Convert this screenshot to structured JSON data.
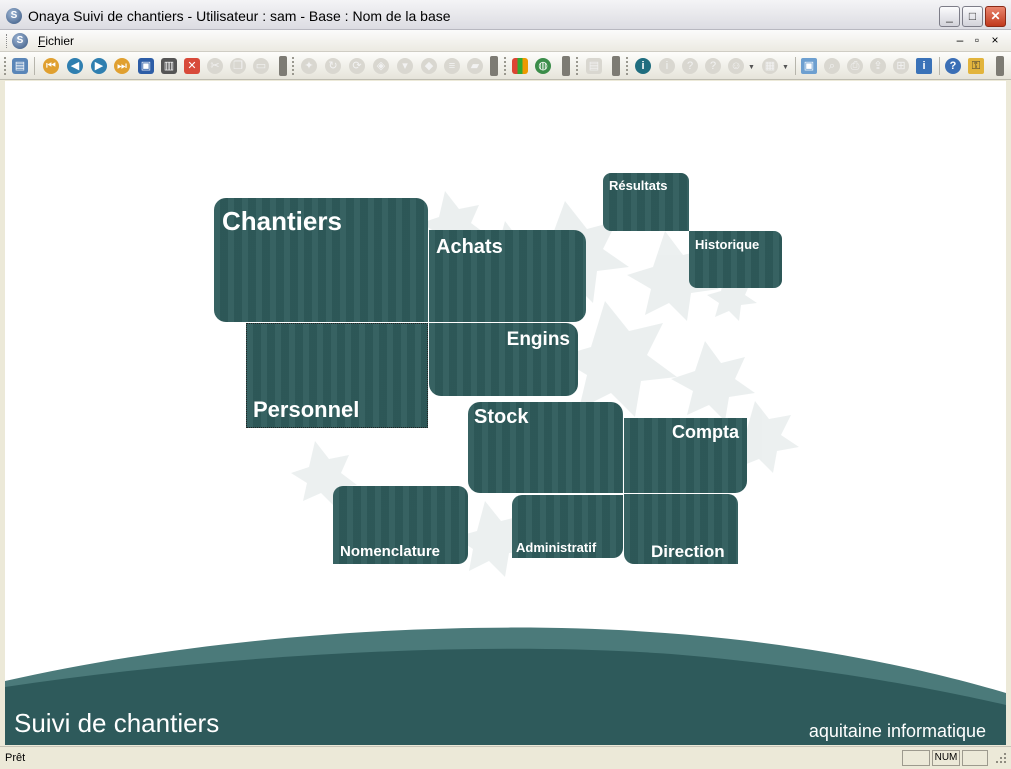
{
  "window": {
    "title": "Onaya Suivi de chantiers - Utilisateur : sam - Base : Nom de la base",
    "app_icon_glyph": "S",
    "minimize_glyph": "_",
    "maximize_glyph": "□",
    "close_glyph": "✕"
  },
  "menubar": {
    "items": [
      {
        "label": "Fichier"
      }
    ],
    "mdi_minimize_glyph": "–",
    "mdi_restore_glyph": "▫",
    "mdi_close_glyph": "×"
  },
  "toolbar": {
    "icons": [
      "notes-icon",
      "first-record-icon",
      "previous-record-icon",
      "next-record-icon",
      "last-record-icon",
      "save-icon",
      "trash-icon",
      "delete-icon",
      "cut-icon",
      "copy-icon",
      "paste-icon",
      "wand-icon",
      "rotate-icon",
      "refresh-icon",
      "lock-icon",
      "filter-icon",
      "cube-icon",
      "stack-icon",
      "eraser-icon",
      "chart-icon",
      "globe-icon",
      "report-icon",
      "info-icon",
      "info-disabled-icon",
      "help-icon",
      "help-disabled-icon",
      "dropdown-icon",
      "user-icon",
      "calendar-icon",
      "zoom-icon",
      "print-icon",
      "export-icon",
      "tree-icon",
      "about-icon",
      "help-round-icon",
      "exit-icon"
    ]
  },
  "colors": {
    "tile": "#2f5c5c",
    "wave_dark": "#2e5a5b",
    "wave_light": "#4b7a7a"
  },
  "menu": {
    "tiles": [
      {
        "name": "chantiers",
        "label": "Chantiers"
      },
      {
        "name": "achats",
        "label": "Achats"
      },
      {
        "name": "resultats",
        "label": "Résultats"
      },
      {
        "name": "historique",
        "label": "Historique"
      },
      {
        "name": "personnel",
        "label": "Personnel"
      },
      {
        "name": "engins",
        "label": "Engins"
      },
      {
        "name": "stock",
        "label": "Stock"
      },
      {
        "name": "compta",
        "label": "Compta"
      },
      {
        "name": "nomenclature",
        "label": "Nomenclature"
      },
      {
        "name": "administratif",
        "label": "Administratif"
      },
      {
        "name": "direction",
        "label": "Direction"
      }
    ]
  },
  "footer": {
    "app_name": "Suivi de chantiers",
    "company": "aquitaine informatique"
  },
  "statusbar": {
    "text": "Prêt",
    "num": "NUM"
  }
}
